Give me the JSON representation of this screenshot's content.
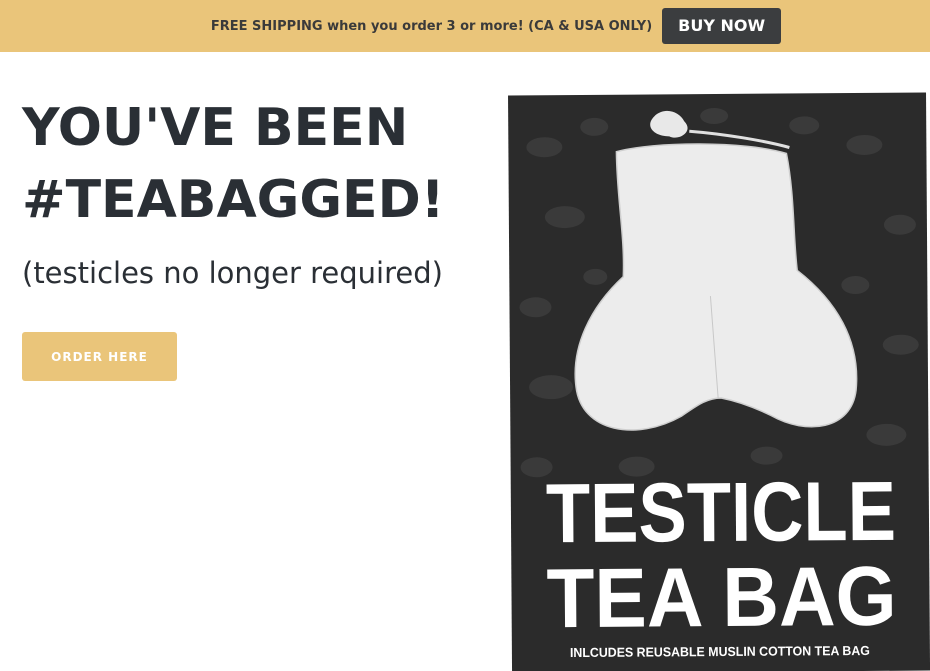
{
  "announcement": {
    "text": "FREE SHIPPING when you order 3 or more! (CA & USA ONLY)",
    "button_label": "BUY NOW"
  },
  "hero": {
    "title_line1": "YOU'VE BEEN",
    "title_line2": "#TEABAGGED!",
    "subtitle": "(testicles no longer required)",
    "cta_label": "ORDER HERE"
  },
  "product_image": {
    "headline_line1": "TESTICLE",
    "headline_line2": "TEA BAG",
    "caption": "INLCUDES REUSABLE MUSLIN COTTON TEA BAG"
  },
  "colors": {
    "accent": "#eac57a",
    "dark_button": "#3b3d3f",
    "heading_text": "#2a2f35",
    "package_bg": "#2b2b2b"
  }
}
